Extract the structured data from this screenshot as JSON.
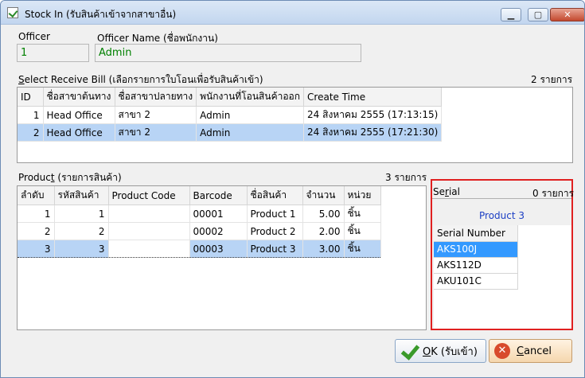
{
  "window": {
    "title": "Stock In (รับสินค้าเข้าจากสาขาอื่น)",
    "minimize": "▁",
    "maximize": "▢",
    "close": "✕"
  },
  "officer": {
    "label": "Officer",
    "value": "1",
    "name_label": "Officer Name (ชื่อพนักงาน)",
    "name_value": "Admin"
  },
  "receive_bill": {
    "label_first": "S",
    "label_rest": "elect Receive Bill (เลือกรายการใบโอนเพื่อรับสินค้าเข้า)",
    "count": "2 รายการ",
    "columns": [
      "ID",
      "ชื่อสาขาต้นทาง",
      "ชื่อสาขาปลายทาง",
      "พนักงานที่โอนสินค้าออก",
      "Create Time"
    ],
    "rows": [
      {
        "id": "1",
        "from": "Head Office",
        "to": "สาขา 2",
        "staff": "Admin",
        "time": "24 สิงหาคม 2555 (17:13:15)"
      },
      {
        "id": "2",
        "from": "Head Office",
        "to": "สาขา 2",
        "staff": "Admin",
        "time": "24 สิงหาคม 2555 (17:21:30)"
      }
    ]
  },
  "product": {
    "label_a": "Produc",
    "label_u": "t",
    "label_b": " (รายการสินค้า)",
    "count": "3 รายการ",
    "columns": [
      "ลำดับ",
      "รหัสสินค้า",
      "Product Code",
      "Barcode",
      "ชื่อสินค้า",
      "จำนวน",
      "หน่วย"
    ],
    "rows": [
      {
        "no": "1",
        "code": "1",
        "pcode": "",
        "barcode": "00001",
        "name": "Product 1",
        "qty": "5.00",
        "unit": "ชิ้น"
      },
      {
        "no": "2",
        "code": "2",
        "pcode": "",
        "barcode": "00002",
        "name": "Product 2",
        "qty": "2.00",
        "unit": "ชิ้น"
      },
      {
        "no": "3",
        "code": "3",
        "pcode": "",
        "barcode": "00003",
        "name": "Product 3",
        "qty": "3.00",
        "unit": "ชิ้น"
      }
    ]
  },
  "serial": {
    "label_a": "Se",
    "label_u": "r",
    "label_b": "ial",
    "count": "0 รายการ",
    "product_name": "Product 3",
    "column": "Serial Number",
    "items": [
      "AKS100J",
      "AKS112D",
      "AKU101C"
    ]
  },
  "buttons": {
    "ok_u": "O",
    "ok_rest": "K (รับเข้า)",
    "cancel_u": "C",
    "cancel_rest": "ancel"
  }
}
